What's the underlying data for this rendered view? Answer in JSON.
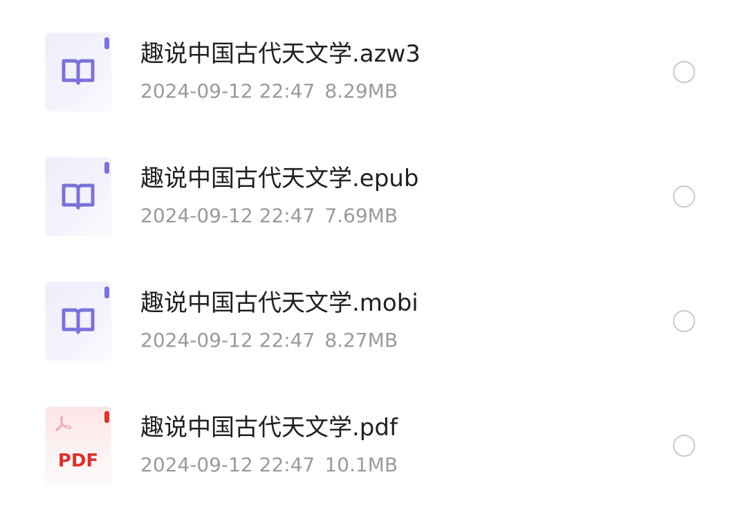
{
  "files": [
    {
      "name": "趣说中国古代天文学.azw3",
      "datetime": "2024-09-12 22:47",
      "size": "8.29MB",
      "icon": "ebook-icon",
      "accent": "#7b72d8"
    },
    {
      "name": "趣说中国古代天文学.epub",
      "datetime": "2024-09-12 22:47",
      "size": "7.69MB",
      "icon": "ebook-icon",
      "accent": "#7b72d8"
    },
    {
      "name": "趣说中国古代天文学.mobi",
      "datetime": "2024-09-12 22:47",
      "size": "8.27MB",
      "icon": "ebook-icon",
      "accent": "#7b72d8"
    },
    {
      "name": "趣说中国古代天文学.pdf",
      "datetime": "2024-09-12 22:47",
      "size": "10.1MB",
      "icon": "pdf-icon",
      "icon_label": "PDF",
      "accent": "#dc3232"
    }
  ],
  "colors": {
    "name_text": "#1f1f1f",
    "meta_text": "#9a9a9a",
    "radio_border": "#c9c9c9",
    "background": "#ffffff"
  }
}
